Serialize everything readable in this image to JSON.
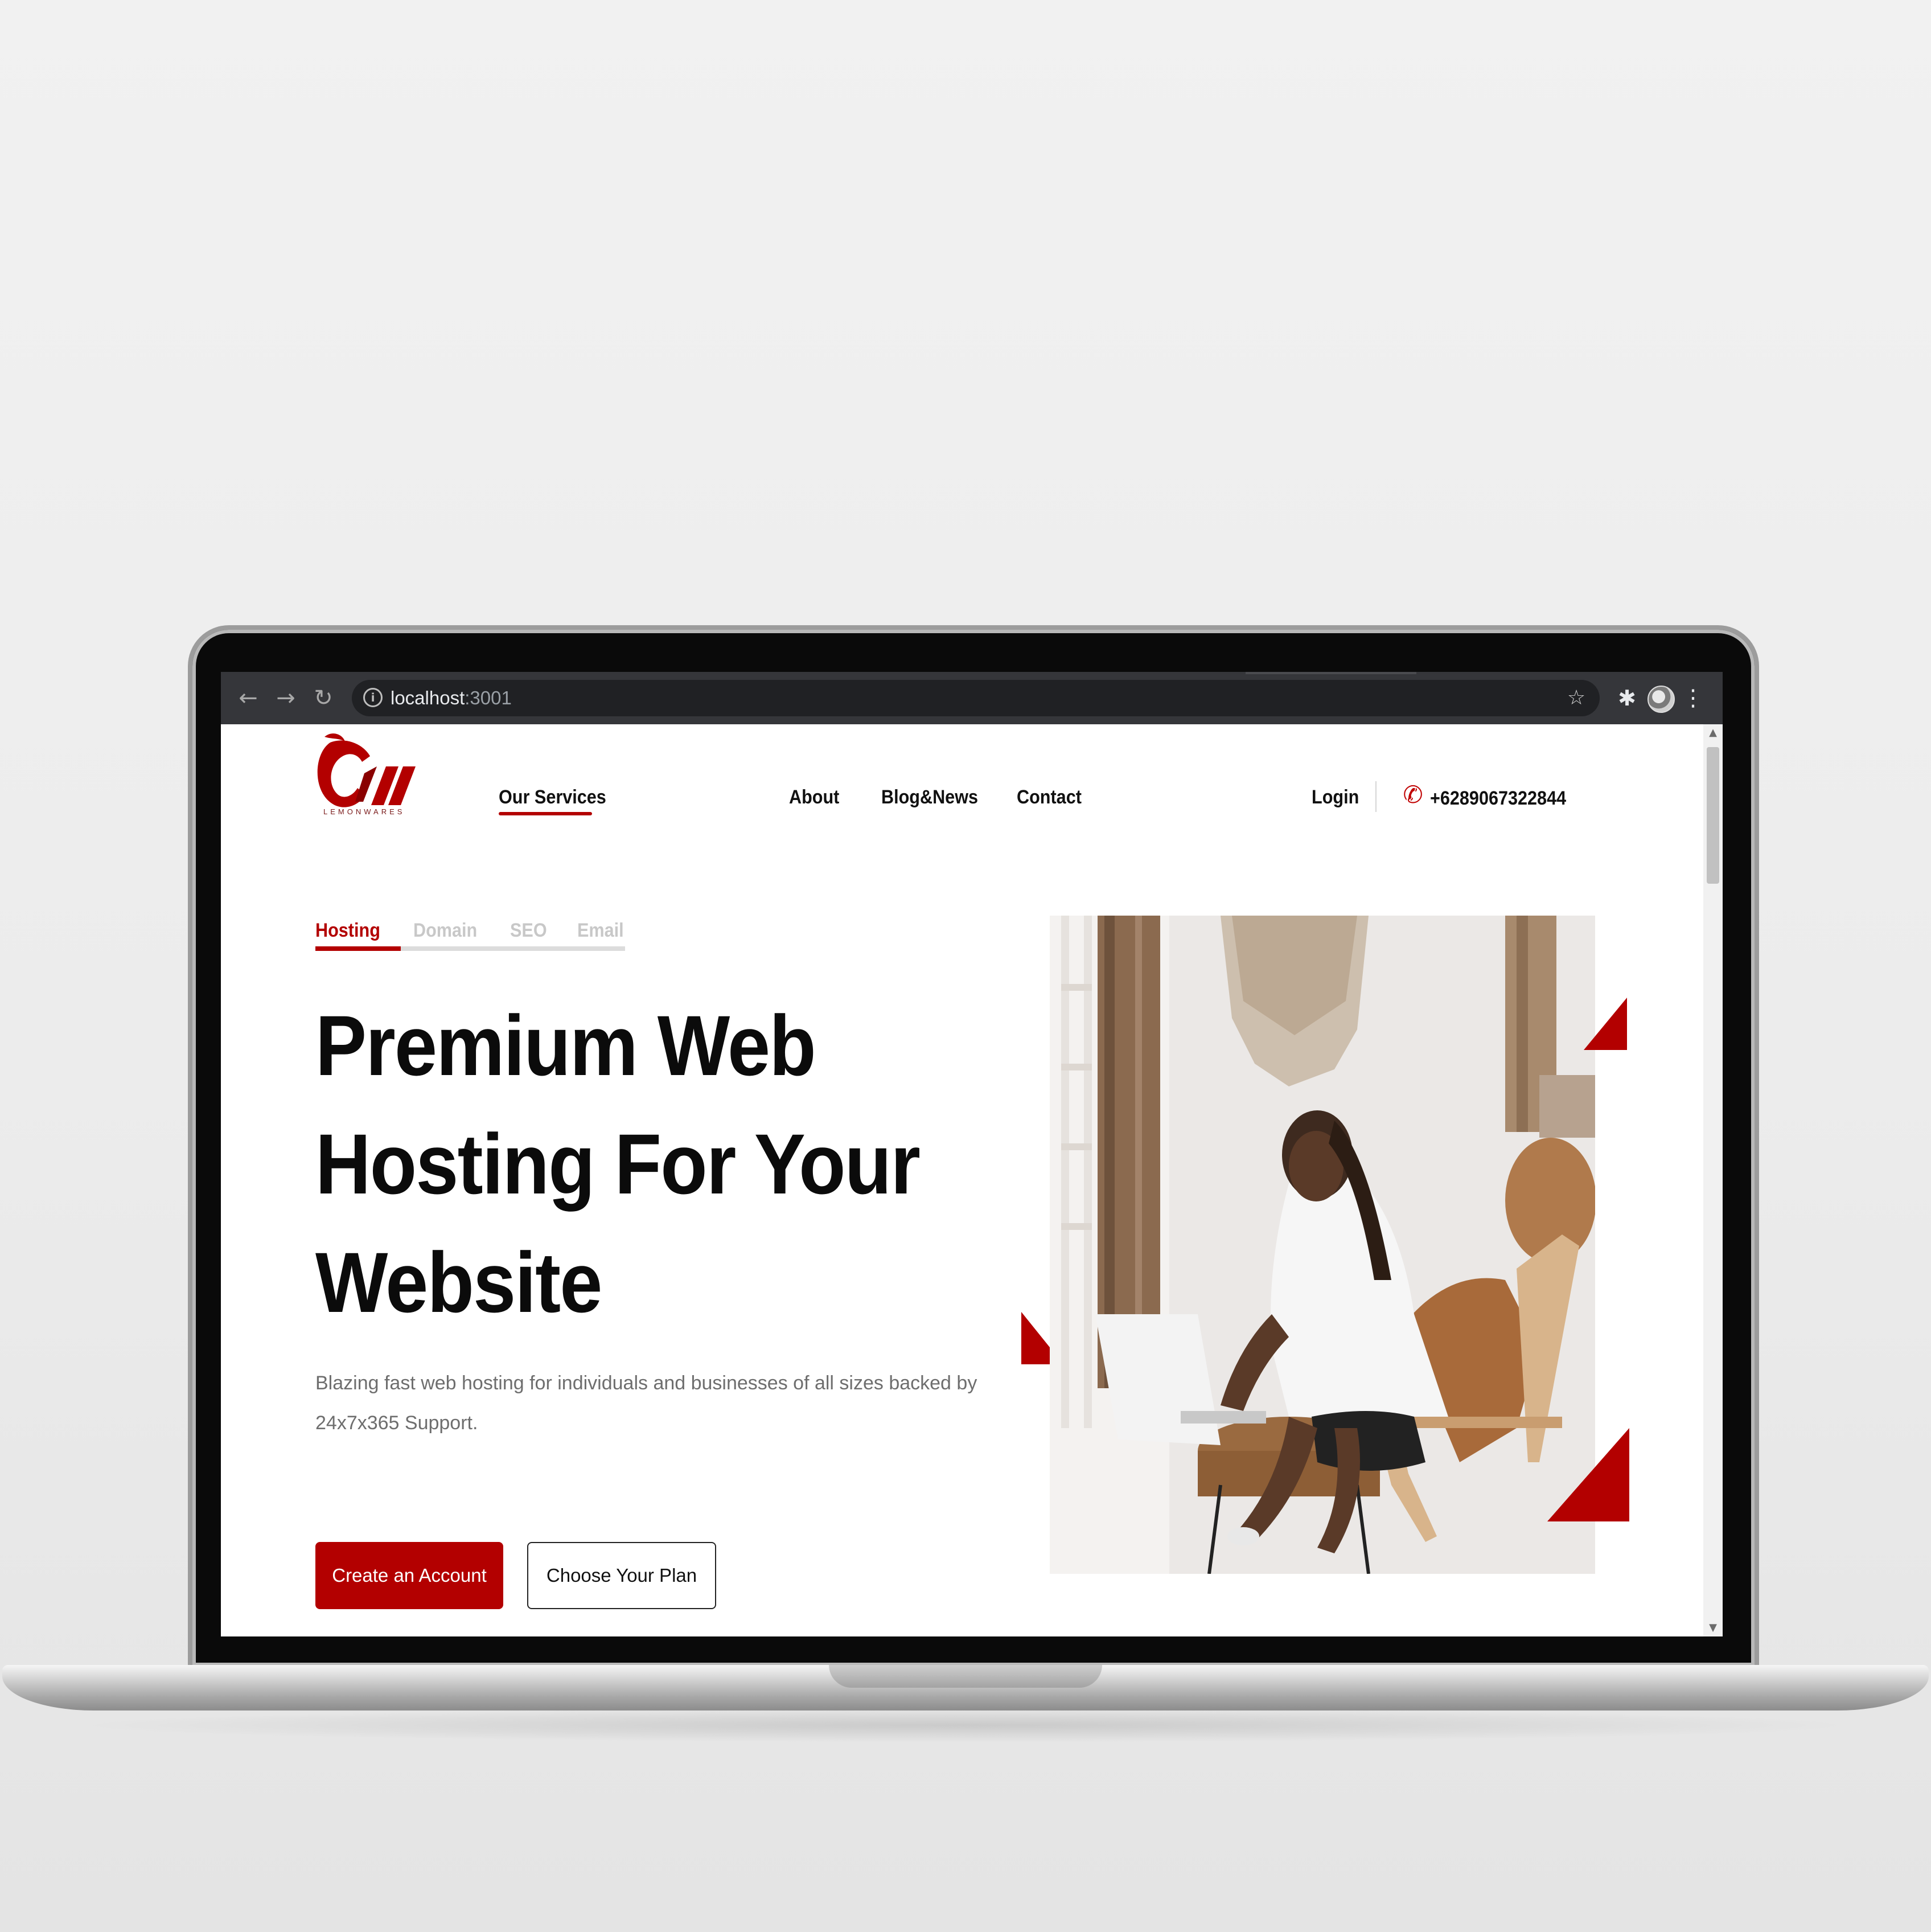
{
  "browser": {
    "url_host": "localhost",
    "url_port": ":3001"
  },
  "header": {
    "logo_text": "LEMONWARES",
    "nav": {
      "our_services": "Our Services",
      "about": "About",
      "blog": "Blog&News",
      "contact": "Contact"
    },
    "login": "Login",
    "phone": "+6289067322844"
  },
  "service_tabs": {
    "hosting": "Hosting",
    "domain": "Domain",
    "seo": "SEO",
    "email": "Email"
  },
  "hero": {
    "title_line1": "Premium Web",
    "title_line2": "Hosting For Your",
    "title_line3": "Website",
    "subtitle": "Blazing fast web hosting for individuals and businesses of all sizes backed by 24x7x365 Support.",
    "primary_cta": "Create an Account",
    "secondary_cta": "Choose Your Plan"
  },
  "colors": {
    "accent": "#b30000",
    "inactive_tab": "#c8c8c8",
    "browser_chrome": "#35363a"
  },
  "icons": [
    "back-icon",
    "forward-icon",
    "reload-icon",
    "info-icon",
    "star-icon",
    "puzzle-icon",
    "kebab-icon",
    "phone-icon"
  ]
}
